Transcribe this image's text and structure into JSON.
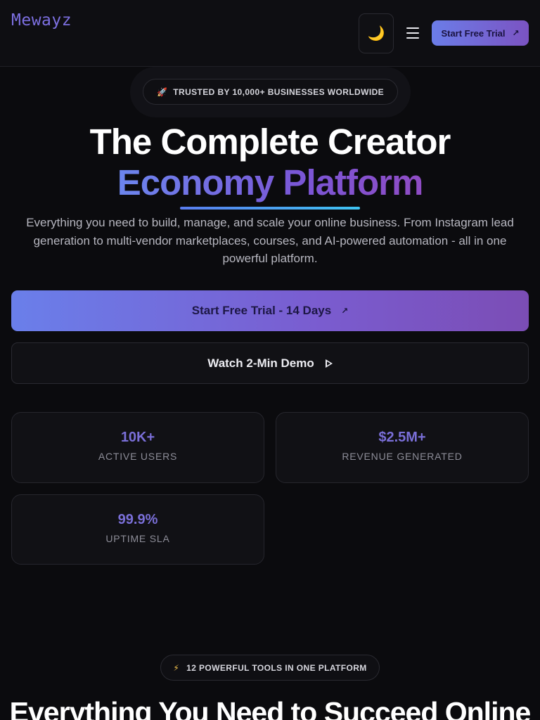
{
  "header": {
    "logo": "Mewayz",
    "theme_icon": "moon-icon",
    "theme_glyph": "🌙",
    "menu_icon": "hamburger-menu-icon",
    "cta_label": "Start Free Trial",
    "cta_icon": "arrow-up-right-icon",
    "cta_glyph": "↗"
  },
  "hero": {
    "badge_icon": "rocket-icon",
    "badge_glyph": "🚀",
    "badge_text": "TRUSTED BY 10,000+ BUSINESSES WORLDWIDE",
    "title_line1": "The Complete Creator",
    "title_line2": "Economy Platform",
    "subtitle": "Everything you need to build, manage, and scale your online business. From Instagram lead generation to multi-vendor marketplaces, courses, and AI-powered automation - all in one powerful platform.",
    "primary_cta": "Start Free Trial - 14 Days",
    "primary_cta_glyph": "↗",
    "secondary_cta": "Watch 2-Min Demo",
    "secondary_cta_icon": "play-icon"
  },
  "stats": [
    {
      "value": "10K+",
      "label": "ACTIVE USERS"
    },
    {
      "value": "$2.5M+",
      "label": "REVENUE GENERATED"
    },
    {
      "value": "99.9%",
      "label": "UPTIME SLA"
    }
  ],
  "features": {
    "badge_icon": "lightning-icon",
    "badge_glyph": "⚡",
    "badge_text": "12 POWERFUL TOOLS IN ONE PLATFORM",
    "title": "Everything You Need to Succeed Online"
  },
  "colors": {
    "background": "#0b0b0e",
    "accent": "#7a6fd8",
    "gradient_start": "#6a7fea",
    "gradient_end": "#7b4db5",
    "underline_end": "#3ec4f2"
  }
}
